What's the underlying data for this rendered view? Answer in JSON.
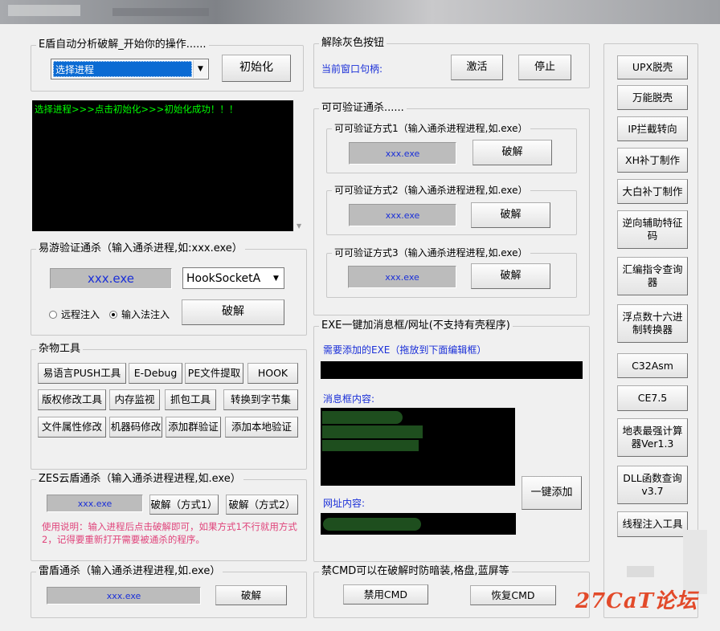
{
  "colors": {
    "accent_blue": "#1a2fd8",
    "log_green": "#00ff00",
    "note_pink": "#e0447b",
    "watermark_red": "#e24a2a"
  },
  "auto": {
    "legend": "E盾自动分析破解_开始你的操作......",
    "process_select": "选择进程",
    "init_button": "初始化",
    "log": "选择进程>>>点击初始化>>>初始化成功！！！"
  },
  "gray": {
    "legend": "解除灰色按钮",
    "handle_label": "当前窗口句柄:",
    "activate_button": "激活",
    "stop_button": "停止"
  },
  "kekeyan": {
    "legend": "可可验证通杀......",
    "methods": [
      {
        "legend": "可可验证方式1（输入通杀进程进程,如.exe）",
        "field": "xxx.exe",
        "button": "破解"
      },
      {
        "legend": "可可验证方式2（输入通杀进程进程,如.exe）",
        "field": "xxx.exe",
        "button": "破解"
      },
      {
        "legend": "可可验证方式3（输入通杀进程进程,如.exe）",
        "field": "xxx.exe",
        "button": "破解"
      }
    ]
  },
  "yiyou": {
    "legend": "易游验证通杀（输入通杀进程,如:xxx.exe）",
    "field": "xxx.exe",
    "hook_select": "HookSocketA",
    "radio_remote": "远程注入",
    "radio_ime": "输入法注入",
    "crack_button": "破解"
  },
  "misc": {
    "legend": "杂物工具",
    "row1": [
      "易语言PUSH工具",
      "E-Debug",
      "PE文件提取",
      "HOOK"
    ],
    "row2": [
      "版权修改工具",
      "内存监视",
      "抓包工具",
      "转换到字节集"
    ],
    "row3": [
      "文件属性修改",
      "机器码修改",
      "添加群验证",
      "添加本地验证"
    ]
  },
  "exe_box": {
    "legend": "EXE一键加消息框/网址(不支持有壳程序)",
    "need_exe_label": "需要添加的EXE（拖放到下面编辑框）",
    "msg_label": "消息框内容:",
    "url_label": "网址内容:",
    "add_button": "一键添加"
  },
  "zes": {
    "legend": "ZES云盾通杀（输入通杀进程进程,如.exe）",
    "field": "xxx.exe",
    "btn1": "破解（方式1）",
    "btn2": "破解（方式2）",
    "note": "使用说明：输入进程后点击破解即可，如果方式1不行就用方式2，记得要重新打开需要被通杀的程序。"
  },
  "leidun": {
    "legend": "雷盾通杀（输入通杀进程进程,如.exe）",
    "field": "xxx.exe",
    "button": "破解"
  },
  "cmd": {
    "legend": "禁CMD可以在破解时防暗装,格盘,蓝屏等",
    "disable_button": "禁用CMD",
    "restore_button": "恢复CMD"
  },
  "sidebar": [
    "UPX脱壳",
    "万能脱壳",
    "IP拦截转向",
    "XH补丁制作",
    "大白补丁制作",
    "逆向辅助特征码",
    "汇编指令查询器",
    "浮点数十六进制转换器",
    "C32Asm",
    "CE7.5",
    "地表最强计算器Ver1.3",
    "DLL函数查询v3.7",
    "线程注入工具"
  ],
  "watermark": "27CaT论坛"
}
